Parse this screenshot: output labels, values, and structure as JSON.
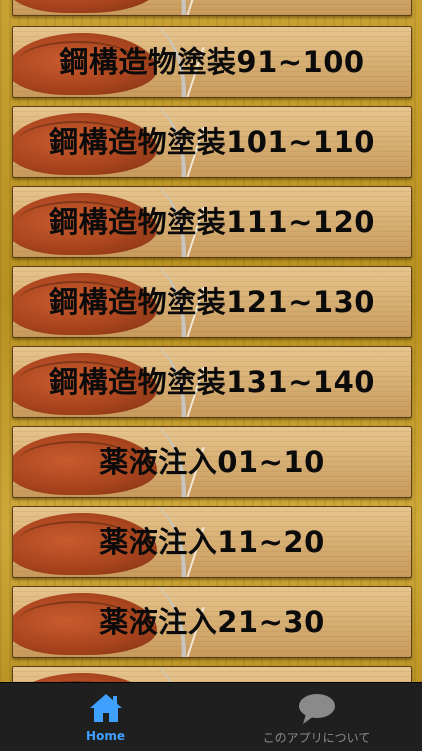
{
  "list": {
    "items": [
      {
        "label": ""
      },
      {
        "label": "鋼構造物塗装91~100"
      },
      {
        "label": "鋼構造物塗装101~110"
      },
      {
        "label": "鋼構造物塗装111~120"
      },
      {
        "label": "鋼構造物塗装121~130"
      },
      {
        "label": "鋼構造物塗装131~140"
      },
      {
        "label": "薬液注入01~10"
      },
      {
        "label": "薬液注入11~20"
      },
      {
        "label": "薬液注入21~30"
      },
      {
        "label": ""
      }
    ]
  },
  "tabbar": {
    "home": {
      "label": "Home",
      "icon": "house-icon",
      "color": "#3fa0ff"
    },
    "about": {
      "label": "このアプリについて",
      "icon": "speech-bubble-icon",
      "color": "#8a8a8a"
    }
  }
}
